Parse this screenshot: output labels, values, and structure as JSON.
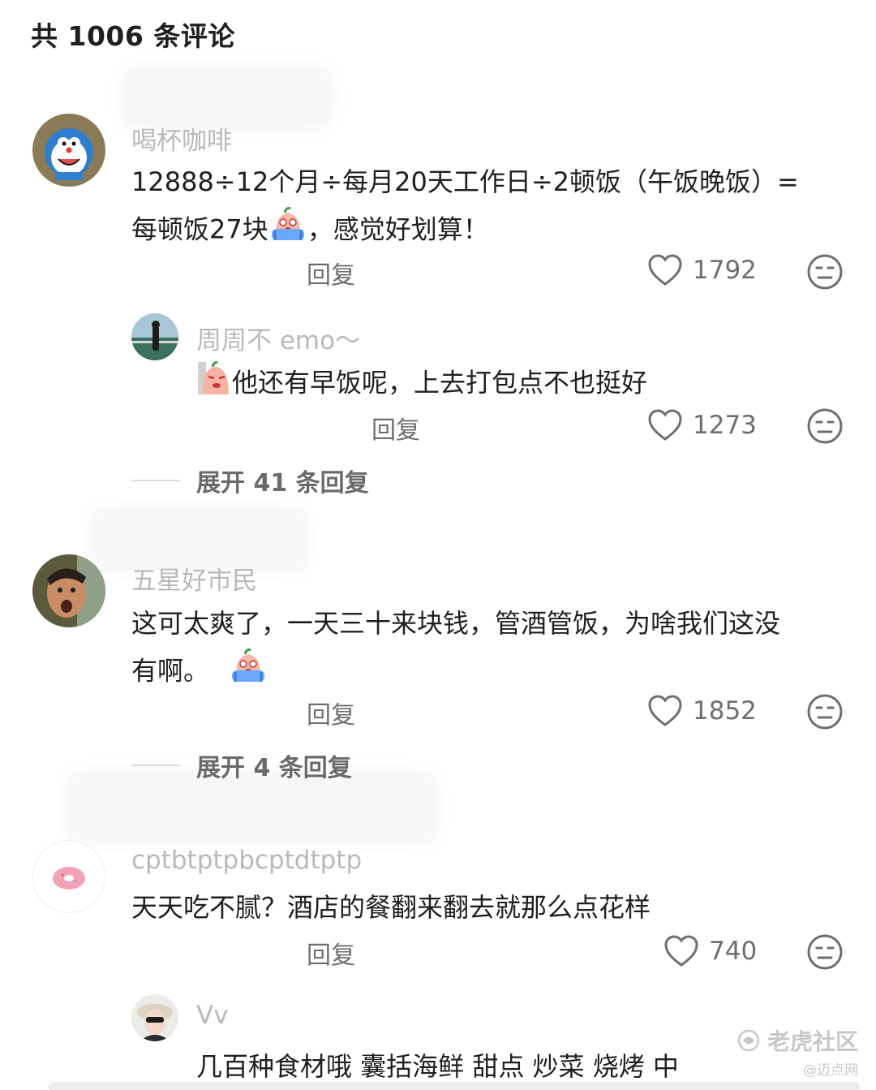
{
  "header": {
    "title": "共 1006 条评论"
  },
  "reply_label": "回复",
  "comments": [
    {
      "username": "喝杯咖啡",
      "text_line1": "12888÷12个月÷每月20天工作日÷2顿饭（午饭晚饭）=",
      "text_line2_a": "每顿饭27块",
      "text_line2_b": "，感觉好划算！",
      "likes": "1792",
      "sub_reply": {
        "username": "周周不 emo～",
        "text": "他还有早饭呢，上去打包点不也挺好",
        "likes": "1273"
      },
      "expand_label": "展开 41 条回复"
    },
    {
      "username": "五星好市民",
      "text_line1": "这可太爽了，一天三十来块钱，管酒管饭，为啥我们这没",
      "text_line2_a": "有啊。",
      "likes": "1852",
      "expand_label": "展开 4 条回复"
    },
    {
      "username": "cptbtptpbcptdtptp",
      "text_line1": "天天吃不腻？酒店的餐翻来翻去就那么点花样",
      "likes": "740",
      "sub_reply": {
        "username": "Vv",
        "text": "几百种食材哦   囊括海鲜   甜点   炒菜   烧烤   中"
      }
    }
  ],
  "watermark": {
    "main": "老虎社区",
    "sub": "@迈点网"
  },
  "colors": {
    "username": "#b9b9b9",
    "meta": "#6e6e6e",
    "text": "#1f1f1f"
  },
  "icons": [
    "heart-outline-icon",
    "neutral-face-icon",
    "crying-emoji-icon",
    "smirk-emoji-icon"
  ]
}
